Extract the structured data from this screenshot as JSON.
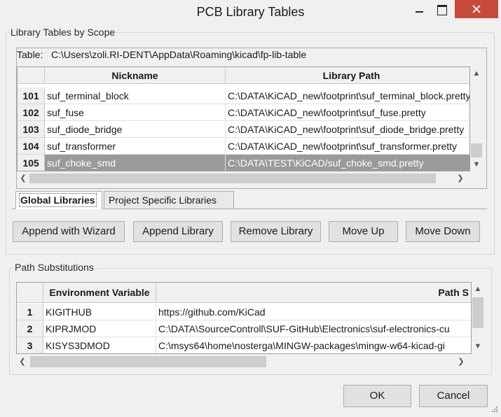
{
  "window": {
    "title": "PCB Library Tables"
  },
  "scope_group": {
    "label": "Library Tables by Scope"
  },
  "table": {
    "path_label": "Table:",
    "path_value": "C:\\Users\\zoli.RI-DENT\\AppData\\Roaming\\kicad\\fp-lib-table",
    "columns": [
      "Nickname",
      "Library Path"
    ],
    "rows": [
      {
        "num": "101",
        "nickname": "suf_terminal_block",
        "path": "C:\\DATA\\KiCAD_new\\footprint\\suf_terminal_block.pretty"
      },
      {
        "num": "102",
        "nickname": "suf_fuse",
        "path": "C:\\DATA\\KiCAD_new\\footprint\\suf_fuse.pretty"
      },
      {
        "num": "103",
        "nickname": "suf_diode_bridge",
        "path": "C:\\DATA\\KiCAD_new\\footprint\\suf_diode_bridge.pretty"
      },
      {
        "num": "104",
        "nickname": "suf_transformer",
        "path": "C:\\DATA\\KiCAD_new\\footprint\\suf_transformer.pretty"
      },
      {
        "num": "105",
        "nickname": "suf_choke_smd",
        "path": "C:\\DATA\\TEST\\KiCAD/suf_choke_smd.pretty"
      }
    ]
  },
  "tabs": [
    "Global Libraries",
    "Project Specific Libraries"
  ],
  "buttons": {
    "append_wizard": "Append with Wizard",
    "append_library": "Append Library",
    "remove_library": "Remove Library",
    "move_up": "Move Up",
    "move_down": "Move Down",
    "ok": "OK",
    "cancel": "Cancel"
  },
  "path_group": {
    "label": "Path Substitutions"
  },
  "env_table": {
    "columns": [
      "Environment Variable",
      "Path S"
    ],
    "rows": [
      {
        "num": "1",
        "name": "KIGITHUB",
        "path": "https://github.com/KiCad"
      },
      {
        "num": "2",
        "name": "KIPRJMOD",
        "path": "C:\\DATA\\SourceControll\\SUF-GitHub\\Electronics\\suf-electronics-cu"
      },
      {
        "num": "3",
        "name": "KISYS3DMOD",
        "path": "C:\\msys64\\home\\nosterga\\MINGW-packages\\mingw-w64-kicad-gi"
      }
    ]
  },
  "colors": {
    "selected_row": "#9a9a9a",
    "close_button": "#c74a3a"
  }
}
